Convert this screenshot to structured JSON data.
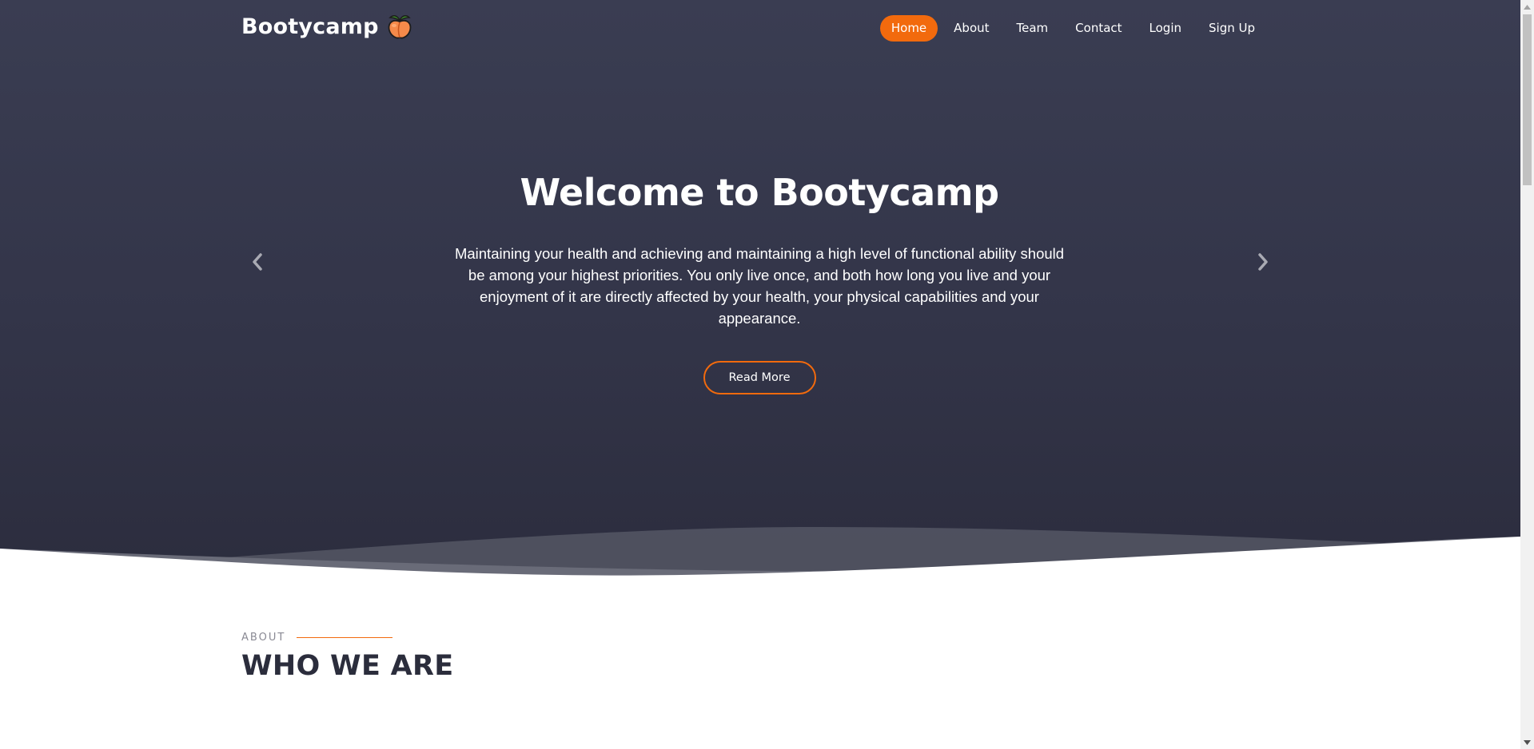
{
  "brand": {
    "name": "Bootycamp",
    "logo_icon": "peach-icon"
  },
  "nav": {
    "items": [
      {
        "label": "Home",
        "active": true
      },
      {
        "label": "About",
        "active": false
      },
      {
        "label": "Team",
        "active": false
      },
      {
        "label": "Contact",
        "active": false
      },
      {
        "label": "Login",
        "active": false
      },
      {
        "label": "Sign Up",
        "active": false
      }
    ]
  },
  "hero": {
    "title": "Welcome to Bootycamp",
    "text": "Maintaining your health and achieving and maintaining a high level of functional ability should be among your highest priorities. You only live once, and both how long you live and your enjoyment of it are directly affected by your health, your physical capabilities and your appearance.",
    "button_label": "Read More",
    "prev_icon": "chevron-left-icon",
    "next_icon": "chevron-right-icon"
  },
  "about": {
    "label": "ABOUT",
    "title": "WHO WE ARE"
  },
  "colors": {
    "accent": "#f26a0d",
    "hero_bg": "#333549",
    "heading_dark": "#2b2d3c"
  }
}
